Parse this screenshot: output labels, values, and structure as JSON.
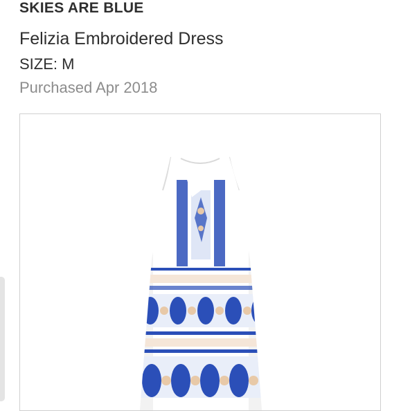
{
  "item": {
    "brand": "SKIES ARE BLUE",
    "name": "Felizia Embroidered Dress",
    "size": "SIZE: M",
    "purchased": "Purchased Apr 2018"
  },
  "image": {
    "subject_icon": "dress-photo",
    "colors": {
      "dress_base": "#ffffff",
      "print_blue": "#2b4fb8",
      "print_peach": "#e8c9a8"
    }
  }
}
